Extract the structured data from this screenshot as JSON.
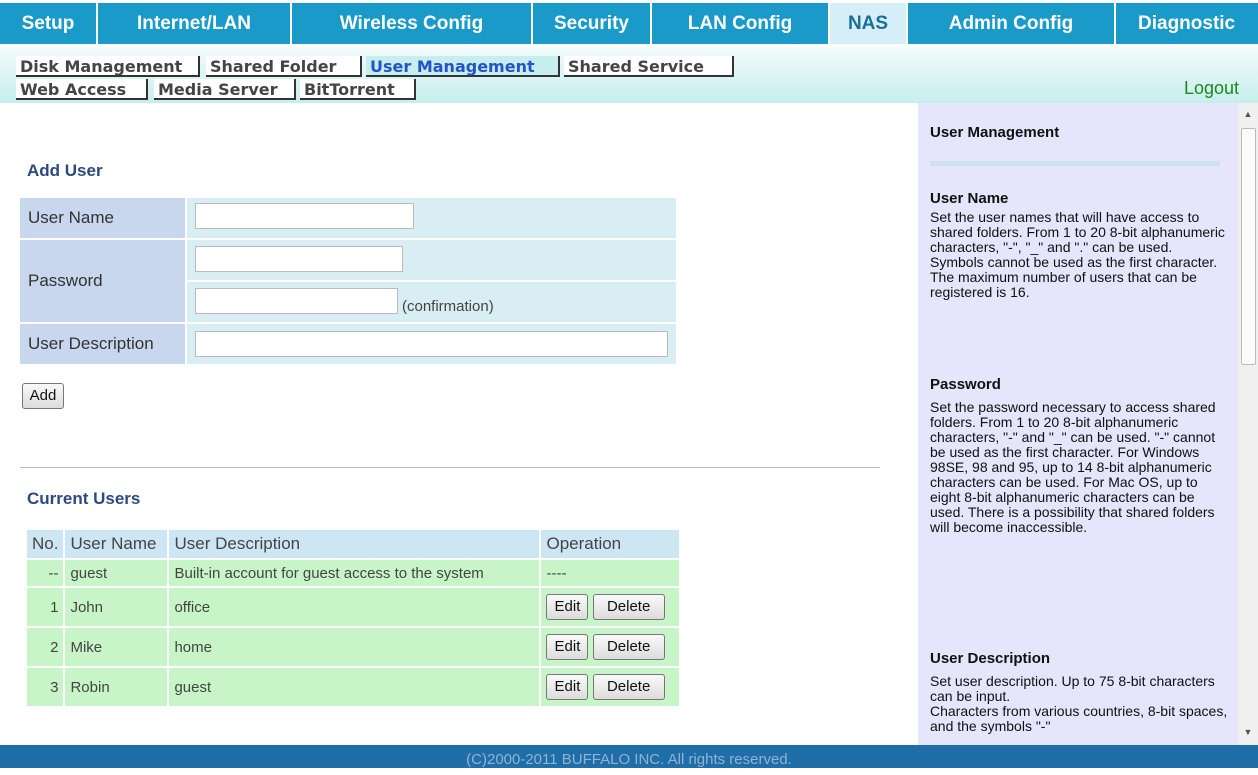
{
  "nav": {
    "tabs": [
      {
        "label": "Setup"
      },
      {
        "label": "Internet/LAN"
      },
      {
        "label": "Wireless Config"
      },
      {
        "label": "Security"
      },
      {
        "label": "LAN Config"
      },
      {
        "label": "NAS"
      },
      {
        "label": "Admin Config"
      },
      {
        "label": "Diagnostic"
      }
    ]
  },
  "subnav": {
    "items": [
      {
        "label": "Disk Management"
      },
      {
        "label": "Shared Folder"
      },
      {
        "label": "User Management"
      },
      {
        "label": "Shared Service"
      },
      {
        "label": "Web Access"
      },
      {
        "label": "Media Server"
      },
      {
        "label": "BitTorrent"
      }
    ],
    "logout": "Logout"
  },
  "add_user": {
    "title": "Add User",
    "username_label": "User Name",
    "password_label": "Password",
    "confirmation_hint": "(confirmation)",
    "description_label": "User Description",
    "add_button": "Add"
  },
  "current_users": {
    "title": "Current Users",
    "headers": [
      "No.",
      "User Name",
      "User Description",
      "Operation"
    ],
    "rows": [
      {
        "no": "--",
        "name": "guest",
        "desc": "Built-in account for guest access to the system",
        "op": "----"
      },
      {
        "no": "1",
        "name": "John",
        "desc": "office"
      },
      {
        "no": "2",
        "name": "Mike",
        "desc": "home"
      },
      {
        "no": "3",
        "name": "Robin",
        "desc": "guest"
      }
    ],
    "edit_label": "Edit",
    "delete_label": "Delete"
  },
  "help": {
    "title": "User Management",
    "sections": [
      {
        "heading": "User Name",
        "text": "Set the user names that will have access to shared folders. From 1 to 20 8-bit alphanumeric characters, \"-\", \"_\" and \".\" can be used. Symbols cannot be used as the first character.\nThe maximum number of users that can be registered is 16."
      },
      {
        "heading": "Password",
        "text": "Set the password necessary to access shared folders. From 1 to 20 8-bit alphanumeric characters, \"-\" and \"_\" can be used. \"-\" cannot be used as the first character. For Windows 98SE, 98 and 95, up to 14 8-bit alphanumeric characters can be used. For Mac OS, up to eight 8-bit alphanumeric characters can be used. There is a possibility that shared folders will become inaccessible."
      },
      {
        "heading": "User Description",
        "text": "Set user description. Up to 75 8-bit characters can be input.\nCharacters from various countries, 8-bit spaces, and the symbols \"-\""
      }
    ]
  },
  "footer": "(C)2000-2011 BUFFALO INC. All rights reserved."
}
